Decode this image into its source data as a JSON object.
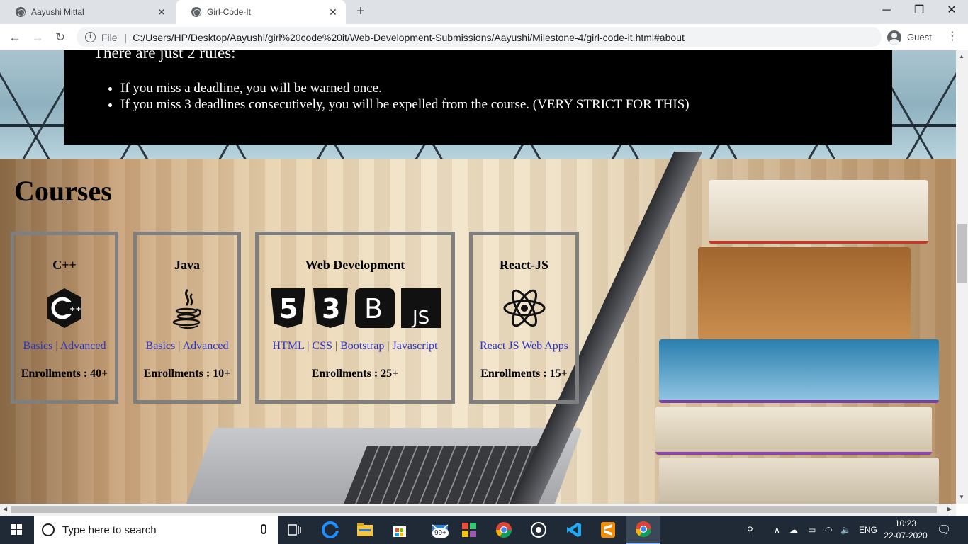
{
  "browser": {
    "tabs": [
      {
        "title": "Aayushi Mittal",
        "active": false
      },
      {
        "title": "Girl-Code-It",
        "active": true
      }
    ],
    "new_tab_symbol": "+",
    "address": {
      "scheme_label": "File",
      "url": "C:/Users/HP/Desktop/Aayushi/girl%20code%20it/Web-Development-Submissions/Aayushi/Milestone-4/girl-code-it.html#about"
    },
    "profile_label": "Guest"
  },
  "rules": {
    "heading": "There are just 2 rules:",
    "items": [
      "If you miss a deadline, you will be warned once.",
      "If you miss 3 deadlines consecutively, you will be expelled from the course. (VERY STRICT FOR THIS)"
    ]
  },
  "courses": {
    "title": "Courses",
    "cards": [
      {
        "name": "C++",
        "links": [
          "Basics",
          "Advanced"
        ],
        "enrollments": "Enrollments : 40+"
      },
      {
        "name": "Java",
        "links": [
          "Basics",
          "Advanced"
        ],
        "enrollments": "Enrollments : 10+"
      },
      {
        "name": "Web Development",
        "links": [
          "HTML",
          "CSS",
          "Bootstrap",
          "Javascript"
        ],
        "enrollments": "Enrollments : 25+",
        "icon_text": [
          "5",
          "3",
          "B",
          "JS"
        ]
      },
      {
        "name": "React-JS",
        "links": [
          "React JS Web Apps"
        ],
        "enrollments": "Enrollments : 15+"
      }
    ],
    "link_separator": "|"
  },
  "taskbar": {
    "search_placeholder": "Type here to search",
    "mail_badge": "99+",
    "language": "ENG",
    "time": "10:23",
    "date": "22-07-2020"
  },
  "colors": {
    "link": "#2a36c9",
    "card_border": "#7f7f7f",
    "rules_bg": "#000000",
    "taskbar": "#1f2a36"
  }
}
